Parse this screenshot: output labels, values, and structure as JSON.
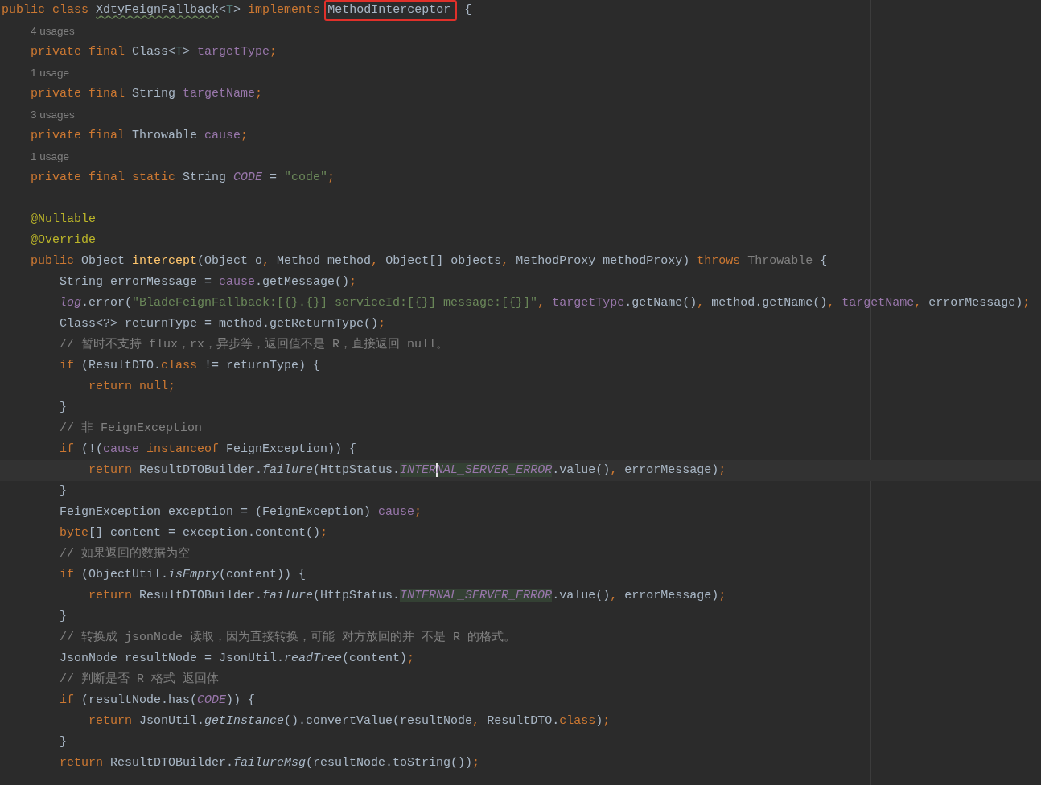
{
  "editor": {
    "lines": [
      {
        "kind": "code",
        "tokens": [
          {
            "kind": "keyword",
            "text": "public class "
          },
          {
            "kind": "plain",
            "text": "XdtyFeignFallback",
            "warning": true
          },
          {
            "kind": "plain",
            "text": "<"
          },
          {
            "kind": "type-param",
            "text": "T"
          },
          {
            "kind": "plain",
            "text": "> "
          },
          {
            "kind": "keyword",
            "text": "implements "
          },
          {
            "kind": "plain",
            "text": "MethodInterceptor",
            "boxed": true
          },
          {
            "kind": "plain",
            "text": " {"
          }
        ]
      },
      {
        "kind": "hint",
        "text": "4 usages"
      },
      {
        "kind": "code",
        "tokens": [
          {
            "kind": "keyword",
            "text": "    private final "
          },
          {
            "kind": "plain",
            "text": "Class<"
          },
          {
            "kind": "type-param",
            "text": "T"
          },
          {
            "kind": "plain",
            "text": "> "
          },
          {
            "kind": "field",
            "text": "targetType"
          },
          {
            "kind": "keyword",
            "text": ";"
          }
        ]
      },
      {
        "kind": "hint",
        "text": "1 usage"
      },
      {
        "kind": "code",
        "tokens": [
          {
            "kind": "keyword",
            "text": "    private final "
          },
          {
            "kind": "plain",
            "text": "String "
          },
          {
            "kind": "field",
            "text": "targetName"
          },
          {
            "kind": "keyword",
            "text": ";"
          }
        ]
      },
      {
        "kind": "hint",
        "text": "3 usages"
      },
      {
        "kind": "code",
        "tokens": [
          {
            "kind": "keyword",
            "text": "    private final "
          },
          {
            "kind": "plain",
            "text": "Throwable "
          },
          {
            "kind": "field",
            "text": "cause"
          },
          {
            "kind": "keyword",
            "text": ";"
          }
        ]
      },
      {
        "kind": "hint",
        "text": "1 usage"
      },
      {
        "kind": "code",
        "tokens": [
          {
            "kind": "keyword",
            "text": "    private final static "
          },
          {
            "kind": "plain",
            "text": "String "
          },
          {
            "kind": "static-field",
            "text": "CODE"
          },
          {
            "kind": "plain",
            "text": " = "
          },
          {
            "kind": "string",
            "text": "\"code\""
          },
          {
            "kind": "keyword",
            "text": ";"
          }
        ]
      },
      {
        "kind": "blank"
      },
      {
        "kind": "code",
        "tokens": [
          {
            "kind": "annotation",
            "text": "    @Nullable"
          }
        ]
      },
      {
        "kind": "code",
        "tokens": [
          {
            "kind": "annotation",
            "text": "    @Override"
          }
        ]
      },
      {
        "kind": "code",
        "tokens": [
          {
            "kind": "keyword",
            "text": "    public "
          },
          {
            "kind": "plain",
            "text": "Object "
          },
          {
            "kind": "method-name",
            "text": "intercept"
          },
          {
            "kind": "plain",
            "text": "(Object o"
          },
          {
            "kind": "keyword",
            "text": ", "
          },
          {
            "kind": "plain",
            "text": "Method method"
          },
          {
            "kind": "keyword",
            "text": ", "
          },
          {
            "kind": "plain",
            "text": "Object[] objects"
          },
          {
            "kind": "keyword",
            "text": ", "
          },
          {
            "kind": "plain",
            "text": "MethodProxy methodProxy) "
          },
          {
            "kind": "keyword",
            "text": "throws "
          },
          {
            "kind": "muted",
            "text": "Throwable"
          },
          {
            "kind": "plain",
            "text": " {"
          }
        ]
      },
      {
        "kind": "code",
        "tokens": [
          {
            "kind": "plain",
            "text": "        String errorMessage = "
          },
          {
            "kind": "field",
            "text": "cause"
          },
          {
            "kind": "plain",
            "text": ".getMessage()"
          },
          {
            "kind": "keyword",
            "text": ";"
          }
        ]
      },
      {
        "kind": "code",
        "tokens": [
          {
            "kind": "static-field",
            "text": "        log"
          },
          {
            "kind": "plain",
            "text": ".error("
          },
          {
            "kind": "string",
            "text": "\"BladeFeignFallback:[{}.{}] serviceId:[{}] message:[{}]\""
          },
          {
            "kind": "keyword",
            "text": ", "
          },
          {
            "kind": "field",
            "text": "targetType"
          },
          {
            "kind": "plain",
            "text": ".getName()"
          },
          {
            "kind": "keyword",
            "text": ", "
          },
          {
            "kind": "plain",
            "text": "method.getName()"
          },
          {
            "kind": "keyword",
            "text": ", "
          },
          {
            "kind": "field",
            "text": "targetName"
          },
          {
            "kind": "keyword",
            "text": ", "
          },
          {
            "kind": "plain",
            "text": "errorMessage)"
          },
          {
            "kind": "keyword",
            "text": ";"
          }
        ]
      },
      {
        "kind": "code",
        "tokens": [
          {
            "kind": "plain",
            "text": "        Class<?> returnType = method.getReturnType()"
          },
          {
            "kind": "keyword",
            "text": ";"
          }
        ]
      },
      {
        "kind": "code",
        "tokens": [
          {
            "kind": "comment",
            "text": "        // 暂时不支持 flux，rx，异步等，返回值不是 R，直接返回 null。"
          }
        ]
      },
      {
        "kind": "code",
        "tokens": [
          {
            "kind": "keyword",
            "text": "        if "
          },
          {
            "kind": "plain",
            "text": "(ResultDTO."
          },
          {
            "kind": "keyword",
            "text": "class"
          },
          {
            "kind": "plain",
            "text": " != returnType) {"
          }
        ]
      },
      {
        "kind": "code",
        "tokens": [
          {
            "kind": "keyword",
            "text": "            return null;"
          }
        ]
      },
      {
        "kind": "code",
        "tokens": [
          {
            "kind": "plain",
            "text": "        }"
          }
        ]
      },
      {
        "kind": "code",
        "tokens": [
          {
            "kind": "comment",
            "text": "        // 非 FeignException"
          }
        ]
      },
      {
        "kind": "code",
        "tokens": [
          {
            "kind": "keyword",
            "text": "        if "
          },
          {
            "kind": "plain",
            "text": "(!("
          },
          {
            "kind": "field",
            "text": "cause"
          },
          {
            "kind": "keyword",
            "text": " instanceof "
          },
          {
            "kind": "plain",
            "text": "FeignException)) {"
          }
        ]
      },
      {
        "kind": "code",
        "current": true,
        "tokens": [
          {
            "kind": "keyword",
            "text": "            return "
          },
          {
            "kind": "plain",
            "text": "ResultDTOBuilder."
          },
          {
            "kind": "static-call",
            "text": "failure"
          },
          {
            "kind": "plain",
            "text": "(HttpStatus."
          },
          {
            "kind": "static-field",
            "text": "INTER",
            "highlighted": true
          },
          {
            "kind": "static-field",
            "text": "NAL_SERVER_ERROR",
            "highlighted": true,
            "caret": true
          },
          {
            "kind": "plain",
            "text": ".value()"
          },
          {
            "kind": "keyword",
            "text": ", "
          },
          {
            "kind": "plain",
            "text": "errorMessage)"
          },
          {
            "kind": "keyword",
            "text": ";"
          }
        ]
      },
      {
        "kind": "code",
        "tokens": [
          {
            "kind": "plain",
            "text": "        }"
          }
        ]
      },
      {
        "kind": "code",
        "tokens": [
          {
            "kind": "plain",
            "text": "        FeignException exception = (FeignException) "
          },
          {
            "kind": "field",
            "text": "cause"
          },
          {
            "kind": "keyword",
            "text": ";"
          }
        ]
      },
      {
        "kind": "code",
        "tokens": [
          {
            "kind": "keyword",
            "text": "        byte"
          },
          {
            "kind": "plain",
            "text": "[] content = exception."
          },
          {
            "kind": "deprecated",
            "text": "content"
          },
          {
            "kind": "plain",
            "text": "()"
          },
          {
            "kind": "keyword",
            "text": ";"
          }
        ]
      },
      {
        "kind": "code",
        "tokens": [
          {
            "kind": "comment",
            "text": "        // 如果返回的数据为空"
          }
        ]
      },
      {
        "kind": "code",
        "tokens": [
          {
            "kind": "keyword",
            "text": "        if "
          },
          {
            "kind": "plain",
            "text": "(ObjectUtil."
          },
          {
            "kind": "static-call",
            "text": "isEmpty"
          },
          {
            "kind": "plain",
            "text": "(content)) {"
          }
        ]
      },
      {
        "kind": "code",
        "tokens": [
          {
            "kind": "keyword",
            "text": "            return "
          },
          {
            "kind": "plain",
            "text": "ResultDTOBuilder."
          },
          {
            "kind": "static-call",
            "text": "failure"
          },
          {
            "kind": "plain",
            "text": "(HttpStatus."
          },
          {
            "kind": "static-field",
            "text": "INTERNAL_SERVER_ERROR",
            "highlighted": true
          },
          {
            "kind": "plain",
            "text": ".value()"
          },
          {
            "kind": "keyword",
            "text": ", "
          },
          {
            "kind": "plain",
            "text": "errorMessage)"
          },
          {
            "kind": "keyword",
            "text": ";"
          }
        ]
      },
      {
        "kind": "code",
        "tokens": [
          {
            "kind": "plain",
            "text": "        }"
          }
        ]
      },
      {
        "kind": "code",
        "tokens": [
          {
            "kind": "comment",
            "text": "        // 转换成 jsonNode 读取，因为直接转换，可能 对方放回的并 不是 R 的格式。"
          }
        ]
      },
      {
        "kind": "code",
        "tokens": [
          {
            "kind": "plain",
            "text": "        JsonNode resultNode = JsonUtil."
          },
          {
            "kind": "static-call",
            "text": "readTree"
          },
          {
            "kind": "plain",
            "text": "(content)"
          },
          {
            "kind": "keyword",
            "text": ";"
          }
        ]
      },
      {
        "kind": "code",
        "tokens": [
          {
            "kind": "comment",
            "text": "        // 判断是否 R 格式 返回体"
          }
        ]
      },
      {
        "kind": "code",
        "tokens": [
          {
            "kind": "keyword",
            "text": "        if "
          },
          {
            "kind": "plain",
            "text": "(resultNode.has("
          },
          {
            "kind": "static-field",
            "text": "CODE"
          },
          {
            "kind": "plain",
            "text": ")) {"
          }
        ]
      },
      {
        "kind": "code",
        "tokens": [
          {
            "kind": "keyword",
            "text": "            return "
          },
          {
            "kind": "plain",
            "text": "JsonUtil."
          },
          {
            "kind": "static-call",
            "text": "getInstance"
          },
          {
            "kind": "plain",
            "text": "().convertValue(resultNode"
          },
          {
            "kind": "keyword",
            "text": ", "
          },
          {
            "kind": "plain",
            "text": "ResultDTO."
          },
          {
            "kind": "keyword",
            "text": "class"
          },
          {
            "kind": "plain",
            "text": ")"
          },
          {
            "kind": "keyword",
            "text": ";"
          }
        ]
      },
      {
        "kind": "code",
        "tokens": [
          {
            "kind": "plain",
            "text": "        }"
          }
        ]
      },
      {
        "kind": "code",
        "tokens": [
          {
            "kind": "keyword",
            "text": "        return "
          },
          {
            "kind": "plain",
            "text": "ResultDTOBuilder."
          },
          {
            "kind": "static-call",
            "text": "failureMsg"
          },
          {
            "kind": "plain",
            "text": "(resultNode.toString())"
          },
          {
            "kind": "keyword",
            "text": ";"
          }
        ]
      }
    ]
  }
}
